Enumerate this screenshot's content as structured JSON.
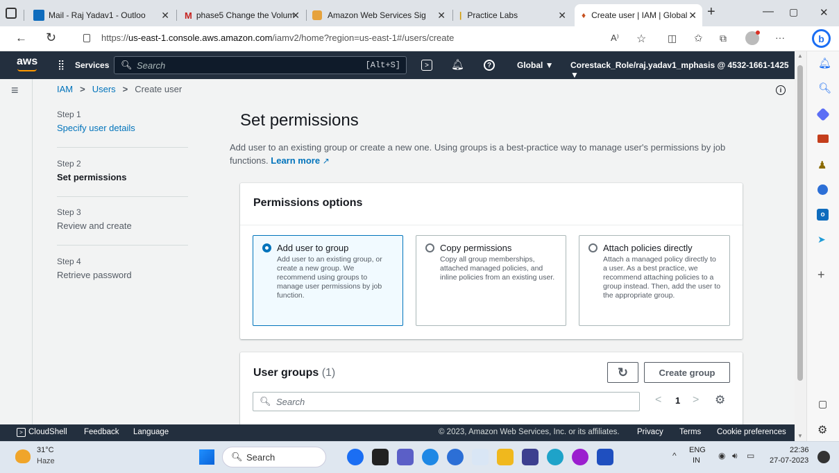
{
  "browser": {
    "tabs": [
      {
        "label": "Mail - Raj Yadav1 - Outloo"
      },
      {
        "label": "phase5 Change the Volum"
      },
      {
        "label": "Amazon Web Services Sig"
      },
      {
        "label": "Practice Labs"
      },
      {
        "label": "Create user | IAM | Global"
      }
    ],
    "url_prefix": "https://",
    "url_domain": "us-east-1.console.aws.amazon.com",
    "url_path": "/iamv2/home?region=us-east-1#/users/create",
    "more": "···"
  },
  "aws_nav": {
    "logo": "aws",
    "services": "Services",
    "search_placeholder": "Search",
    "shortcut": "[Alt+S]",
    "region": "Global ▼",
    "account": "Corestack_Role/raj.yadav1_mphasis @ 4532-1661-1425 ▼"
  },
  "breadcrumb": {
    "iam": "IAM",
    "users": "Users",
    "current": "Create user",
    "sep": ">"
  },
  "steps": [
    {
      "num": "Step 1",
      "label": "Specify user details"
    },
    {
      "num": "Step 2",
      "label": "Set permissions"
    },
    {
      "num": "Step 3",
      "label": "Review and create"
    },
    {
      "num": "Step 4",
      "label": "Retrieve password"
    }
  ],
  "main": {
    "title": "Set permissions",
    "description": "Add user to an existing group or create a new one. Using groups is a best-practice way to manage user's permissions by job functions.",
    "learn_more": "Learn more"
  },
  "permissions": {
    "title": "Permissions options",
    "options": [
      {
        "title": "Add user to group",
        "desc": "Add user to an existing group, or create a new group. We recommend using groups to manage user permissions by job function.",
        "selected": true
      },
      {
        "title": "Copy permissions",
        "desc": "Copy all group memberships, attached managed policies, and inline policies from an existing user.",
        "selected": false
      },
      {
        "title": "Attach policies directly",
        "desc": "Attach a managed policy directly to a user. As a best practice, we recommend attaching policies to a group instead. Then, add the user to the appropriate group.",
        "selected": false
      }
    ]
  },
  "user_groups": {
    "title": "User groups",
    "count": "(1)",
    "create_button": "Create group",
    "search_placeholder": "Search",
    "page": "1",
    "prev": "<",
    "next": ">"
  },
  "footer": {
    "cloudshell": "CloudShell",
    "feedback": "Feedback",
    "language": "Language",
    "copyright": "© 2023, Amazon Web Services, Inc. or its affiliates.",
    "privacy": "Privacy",
    "terms": "Terms",
    "cookie": "Cookie preferences"
  },
  "taskbar": {
    "weather_temp": "31°C",
    "weather_desc": "Haze",
    "search": "Search",
    "lang1": "ENG",
    "lang2": "IN",
    "time": "22:36",
    "date": "27-07-2023"
  },
  "colors": {
    "aws_nav": "#232f3e",
    "link": "#0073bb",
    "selected_bg": "#f1faff"
  }
}
